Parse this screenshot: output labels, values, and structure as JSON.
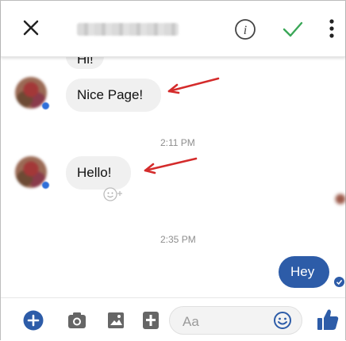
{
  "messages": [
    {
      "id": "hi",
      "text": "Hi!",
      "side": "left"
    },
    {
      "id": "nice",
      "text": "Nice Page!",
      "side": "left"
    },
    {
      "id": "hello",
      "text": "Hello!",
      "side": "left"
    },
    {
      "id": "hey",
      "text": "Hey",
      "side": "right"
    }
  ],
  "timestamps": [
    "2:11 PM",
    "2:35 PM"
  ],
  "composer": {
    "placeholder": "Aa"
  },
  "colors": {
    "accent": "#2d5ca8",
    "check": "#3aa757",
    "annotation_arrow": "#d42b2b",
    "bubble_gray": "#f0f0f0"
  },
  "icons": {
    "header": [
      "close-icon",
      "info-icon",
      "check-icon",
      "more-vert-icon"
    ],
    "composer": [
      "add-circle-icon",
      "camera-icon",
      "image-icon",
      "sticker-icon",
      "emoji-icon",
      "thumbs-up-icon"
    ]
  }
}
